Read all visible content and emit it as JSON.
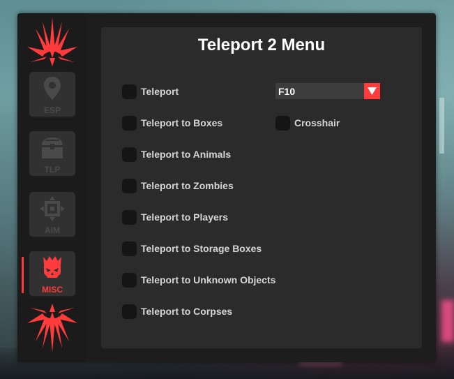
{
  "sidebar": {
    "items": [
      {
        "label": "ESP",
        "icon": "map-pin-icon",
        "active": false
      },
      {
        "label": "TLP",
        "icon": "treasure-chest-icon",
        "active": false
      },
      {
        "label": "AIM",
        "icon": "crosshair-icon",
        "active": false
      },
      {
        "label": "MISC",
        "icon": "crowned-skull-icon",
        "active": true
      }
    ]
  },
  "panel": {
    "title": "Teleport 2 Menu",
    "options": [
      {
        "label": "Teleport",
        "checked": false
      },
      {
        "label": "Teleport to Boxes",
        "checked": false
      },
      {
        "label": "Teleport to Animals",
        "checked": false
      },
      {
        "label": "Teleport to Zombies",
        "checked": false
      },
      {
        "label": "Teleport to Players",
        "checked": false
      },
      {
        "label": "Teleport to Storage Boxes",
        "checked": false
      },
      {
        "label": "Teleport to Unknown Objects",
        "checked": false
      },
      {
        "label": "Teleport to Corpses",
        "checked": false
      }
    ],
    "keybind": {
      "value": "F10"
    },
    "crosshair": {
      "label": "Crosshair",
      "checked": false
    }
  },
  "colors": {
    "accent": "#ff3b3b",
    "panel": "#2b2b2b",
    "sidebar": "#1b1b1b",
    "checkbox": "#151515",
    "inactive_icon": "#4a4a4a"
  }
}
